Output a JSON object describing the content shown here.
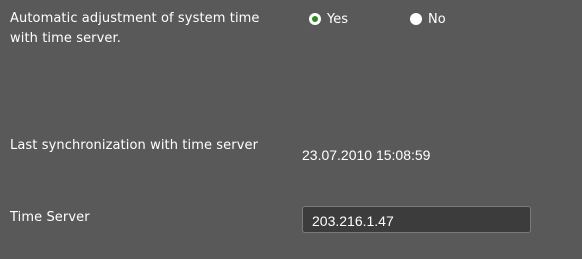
{
  "auto_adjust": {
    "label": "Automatic adjustment of system time with time server.",
    "options": [
      {
        "label": "Yes",
        "selected": true
      },
      {
        "label": "No",
        "selected": false
      }
    ]
  },
  "last_sync": {
    "label": "Last synchronization with time server",
    "value": "23.07.2010 15:08:59"
  },
  "time_server": {
    "label": "Time Server",
    "value": "203.216.1.47"
  },
  "colors": {
    "background": "#595959",
    "radio_selected_dot": "#2b8a1e",
    "input_background": "#3c3c3c"
  }
}
